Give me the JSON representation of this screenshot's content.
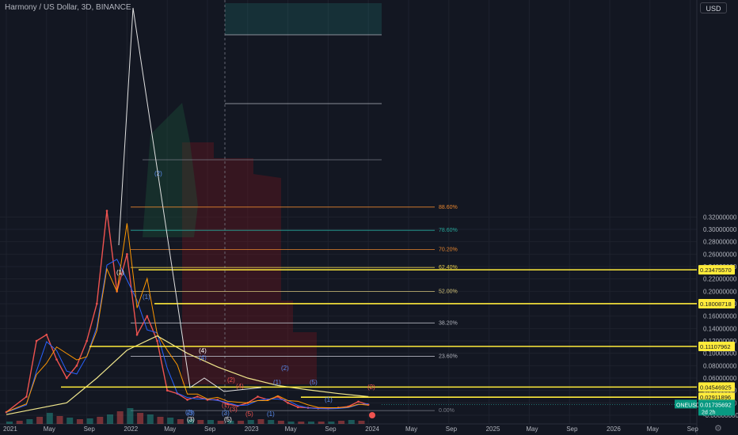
{
  "header": {
    "title": "Harmony / US Dollar, 3D, BINANCE",
    "currency": "USD",
    "settings_icon": "gear-icon"
  },
  "chart_data": {
    "type": "line",
    "title": "Harmony / US Dollar, 3D, BINANCE",
    "y_axis_ticks": [
      "0.32000000",
      "0.30000000",
      "0.28000000",
      "0.26000000",
      "0.24000000",
      "0.22000000",
      "0.20000000",
      "0.18000000",
      "0.16000000",
      "0.14000000",
      "0.12000000",
      "0.10000000",
      "0.08000000",
      "0.06000000",
      "0.04000000",
      "0.02000000",
      "-0.00000000"
    ],
    "ylim": [
      -0.005,
      0.33
    ],
    "x_axis_ticks": [
      "2021",
      "May",
      "Sep",
      "2022",
      "May",
      "Sep",
      "2023",
      "May",
      "Sep",
      "2024",
      "May",
      "Sep",
      "2025",
      "May",
      "Sep",
      "2026",
      "May",
      "Sep"
    ],
    "fib_levels": [
      {
        "label": "0.00%",
        "value": 0.0075
      },
      {
        "label": "23.60%",
        "value": 0.095
      },
      {
        "label": "38.20%",
        "value": 0.149
      },
      {
        "label": "52.00%",
        "value": 0.2
      },
      {
        "label": "62.40%",
        "value": 0.2385
      },
      {
        "label": "70.20%",
        "value": 0.2675
      },
      {
        "label": "78.60%",
        "value": 0.2985
      },
      {
        "label": "88.60%",
        "value": 0.336
      }
    ],
    "horizontal_levels": [
      "0.23475570",
      "0.18008718",
      "0.11107962",
      "0.04546925",
      "0.02911896"
    ],
    "current_price": {
      "symbol": "ONEUSD",
      "value": "0.01735692",
      "countdown": "2d 2h"
    },
    "wave_labels": [
      "(1)",
      "(1)",
      "(2)",
      "(3)",
      "(4)",
      "(4)",
      "(5)",
      "(1)",
      "(2)",
      "(2)",
      "(3)",
      "(4)",
      "(5)",
      "(5)",
      "(1)",
      "(2)",
      "(3)",
      "(1)",
      "(2)",
      "(1)",
      "(3)"
    ],
    "price_series": {
      "name": "ONEUSD",
      "x": [
        "2021-01",
        "2021-03",
        "2021-04",
        "2021-05",
        "2021-06",
        "2021-07",
        "2021-08",
        "2021-09",
        "2021-10",
        "2021-11",
        "2021-12",
        "2022-01",
        "2022-02",
        "2022-03",
        "2022-04",
        "2022-05",
        "2022-06",
        "2022-07",
        "2022-08",
        "2022-09",
        "2022-10",
        "2022-11",
        "2022-12",
        "2023-01",
        "2023-02",
        "2023-03",
        "2023-04",
        "2023-05",
        "2023-06",
        "2023-07",
        "2023-08",
        "2023-09",
        "2023-10",
        "2023-11",
        "2023-12",
        "2024-01"
      ],
      "y": [
        0.005,
        0.03,
        0.12,
        0.13,
        0.09,
        0.06,
        0.08,
        0.12,
        0.18,
        0.33,
        0.2,
        0.26,
        0.13,
        0.16,
        0.12,
        0.04,
        0.035,
        0.025,
        0.03,
        0.025,
        0.025,
        0.018,
        0.015,
        0.02,
        0.03,
        0.025,
        0.03,
        0.02,
        0.013,
        0.012,
        0.011,
        0.011,
        0.012,
        0.014,
        0.022,
        0.017
      ]
    },
    "moving_average": {
      "x": [
        "2021-01",
        "2021-07",
        "2021-10",
        "2022-01",
        "2022-04",
        "2022-07",
        "2022-10",
        "2023-01",
        "2023-04",
        "2023-07",
        "2023-10",
        "2024-01"
      ],
      "y": [
        0.001,
        0.02,
        0.06,
        0.105,
        0.128,
        0.1,
        0.078,
        0.06,
        0.048,
        0.041,
        0.035,
        0.03
      ]
    },
    "legend": "none",
    "grid": true
  }
}
